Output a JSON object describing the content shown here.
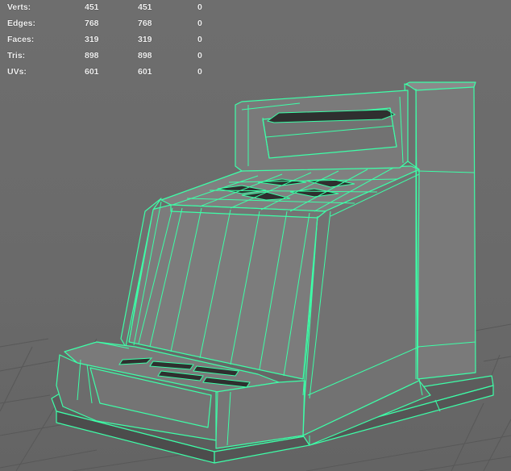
{
  "hud": {
    "rows": [
      {
        "label": "Verts:",
        "a": "451",
        "b": "451",
        "c": "0"
      },
      {
        "label": "Edges:",
        "a": "768",
        "b": "768",
        "c": "0"
      },
      {
        "label": "Faces:",
        "a": "319",
        "b": "319",
        "c": "0"
      },
      {
        "label": "Tris:",
        "a": "898",
        "b": "898",
        "c": "0"
      },
      {
        "label": "UVs:",
        "a": "601",
        "b": "601",
        "c": "0"
      }
    ]
  },
  "colors": {
    "background": "#6b6b6b",
    "grid": "#5a5a5a",
    "mesh_face": "#767676",
    "wireframe": "#3dffa8",
    "dark_slots": "#2e2e2e"
  }
}
